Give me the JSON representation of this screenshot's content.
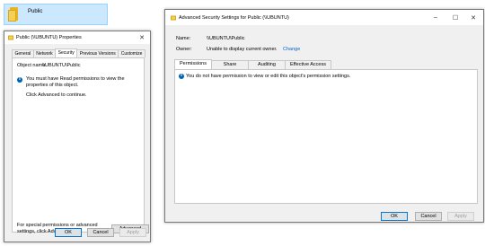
{
  "desktop": {
    "folder_label": "Public"
  },
  "properties_window": {
    "title": "Public (\\\\UBUNTU) Properties",
    "tabs": [
      "General",
      "Network",
      "Security",
      "Previous Versions",
      "Customize"
    ],
    "active_tab": "Security",
    "object_name_label": "Object name:",
    "object_name_value": "\\\\UBUNTU\\Public",
    "read_permission_message": "You must have Read permissions to view the properties of this object.",
    "continue_message": "Click Advanced to continue.",
    "special_permissions_text": "For special permissions or advanced settings, click Advanced.",
    "advanced_button": "Advanced",
    "ok_button": "OK",
    "cancel_button": "Cancel",
    "apply_button": "Apply"
  },
  "advanced_window": {
    "title": "Advanced Security Settings for Public (\\\\UBUNTU)",
    "name_label": "Name:",
    "name_value": "\\\\UBUNTU\\Public",
    "owner_label": "Owner:",
    "owner_value": "Unable to display current owner.",
    "change_link": "Change",
    "tabs": [
      "Permissions",
      "Share",
      "Auditing",
      "Effective Access"
    ],
    "active_tab": "Permissions",
    "no_permission_message": "You do not have permission to view or edit this object's permission settings.",
    "ok_button": "OK",
    "cancel_button": "Cancel",
    "apply_button": "Apply"
  },
  "colors": {
    "selection_bg": "#cce8ff",
    "link": "#0066cc",
    "info_icon": "#0063b1",
    "default_button_border": "#0078d7"
  }
}
